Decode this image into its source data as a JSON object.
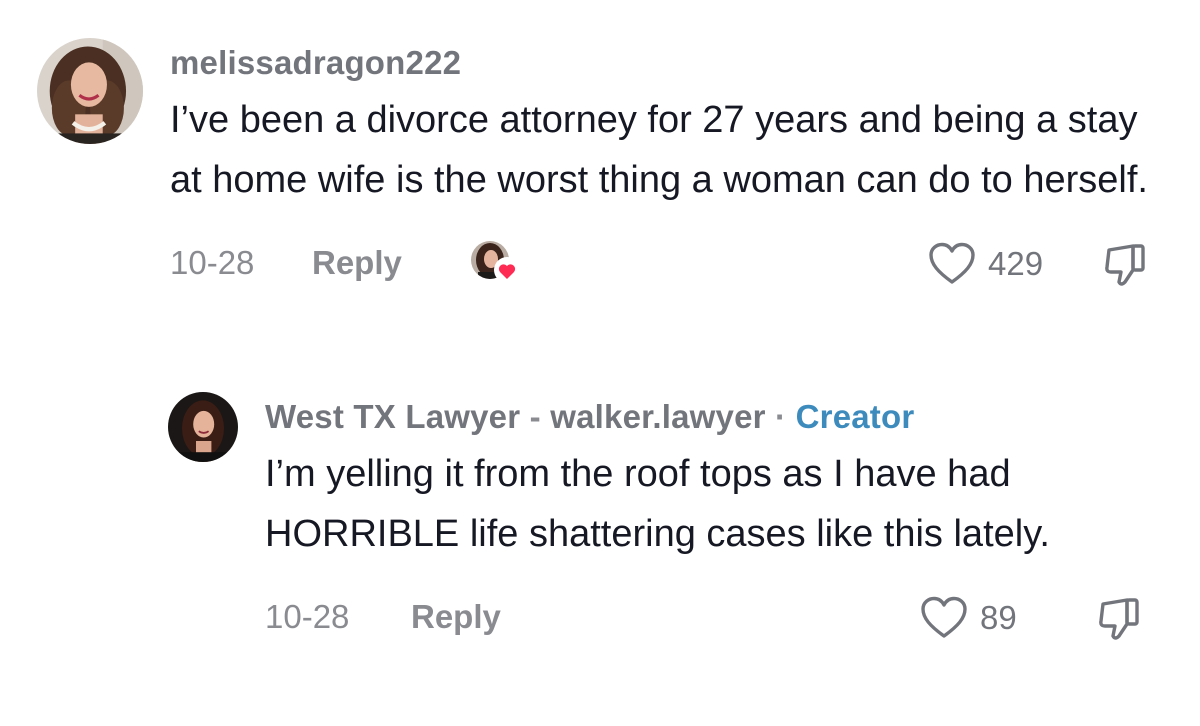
{
  "comments": [
    {
      "username": "melissadragon222",
      "text": "I’ve been a divorce attorney for 27 years and being a stay at home wife is the worst thing a woman can do to herself.",
      "date": "10-28",
      "reply_label": "Reply",
      "likes": "429",
      "liked_by_creator": true,
      "avatar_icon": "user-avatar-photo"
    },
    {
      "display_name": "West TX Lawyer",
      "separator": "-",
      "handle": "walker.lawyer",
      "dot": "·",
      "badge": "Creator",
      "text": "I’m yelling it from the roof tops as I have had HORRIBLE life shattering cases like this lately.",
      "date": "10-28",
      "reply_label": "Reply",
      "likes": "89",
      "avatar_icon": "creator-avatar-photo"
    }
  ],
  "icons": {
    "like": "heart-outline-icon",
    "dislike": "thumbs-down-icon",
    "liked_by_creator": "creator-heart-badge-icon"
  },
  "colors": {
    "text": "#161823",
    "muted": "#8a8b91",
    "creator_badge": "#3d8bbd",
    "heart_badge": "#fe2c55"
  }
}
